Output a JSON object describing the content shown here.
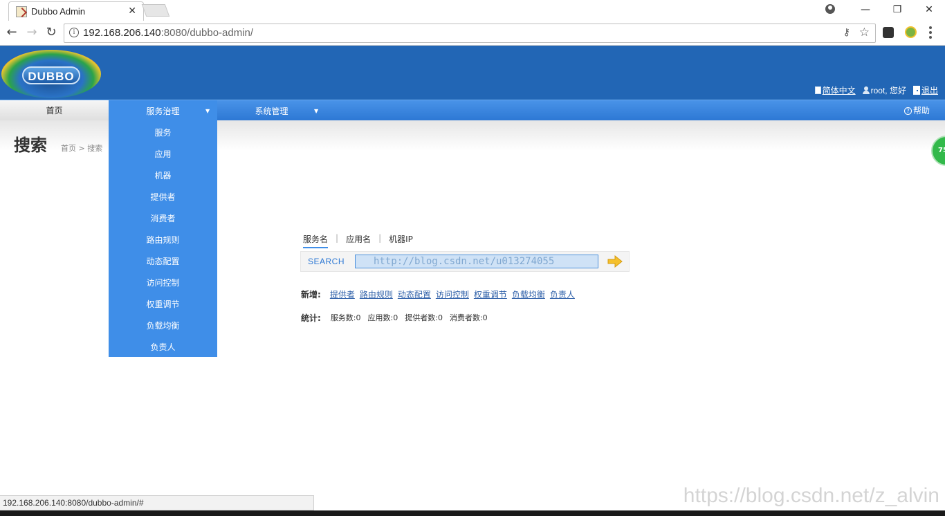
{
  "browser": {
    "tab_title": "Dubbo Admin",
    "tab_close": "✕",
    "url_host": "192.168.206.140",
    "url_rest": ":8080/dubbo-admin/",
    "status_url": "192.168.206.140:8080/dubbo-admin/#",
    "win_min": "—",
    "win_restore": "❐",
    "win_close": "✕",
    "back": "←",
    "forward": "→",
    "reload": "↻",
    "info": "i",
    "key_icon": "⚷",
    "star_icon": "☆"
  },
  "header": {
    "logo_text": "DUBBO",
    "language": "简体中文",
    "user": "root, 您好",
    "logout": "退出"
  },
  "nav": {
    "home": "首页",
    "governance": "服务治理",
    "system": "系统管理",
    "help": "帮助",
    "caret": "▼"
  },
  "dropdown": {
    "items": [
      "服务",
      "应用",
      "机器",
      "提供者",
      "消费者",
      "路由规则",
      "动态配置",
      "访问控制",
      "权重调节",
      "负载均衡",
      "负责人"
    ]
  },
  "page": {
    "title": "搜索",
    "breadcrumb": "首页 > 搜索",
    "side_badge": "75"
  },
  "search": {
    "tabs": [
      "服务名",
      "应用名",
      "机器IP"
    ],
    "separator": "|",
    "label": "SEARCH",
    "value": "http://blog.csdn.net/u013274055"
  },
  "add_links": {
    "label": "新增:",
    "items": [
      "提供者",
      "路由规则",
      "动态配置",
      "访问控制",
      "权重调节",
      "负载均衡",
      "负责人"
    ]
  },
  "stats": {
    "label": "统计:",
    "items": [
      "服务数:0",
      "应用数:0",
      "提供者数:0",
      "消费者数:0"
    ]
  },
  "watermark": "https://blog.csdn.net/z_alvin",
  "colors": {
    "header_blue": "#2266b5",
    "nav_blue": "#3f8ee8",
    "link_blue": "#2d5fa8"
  }
}
